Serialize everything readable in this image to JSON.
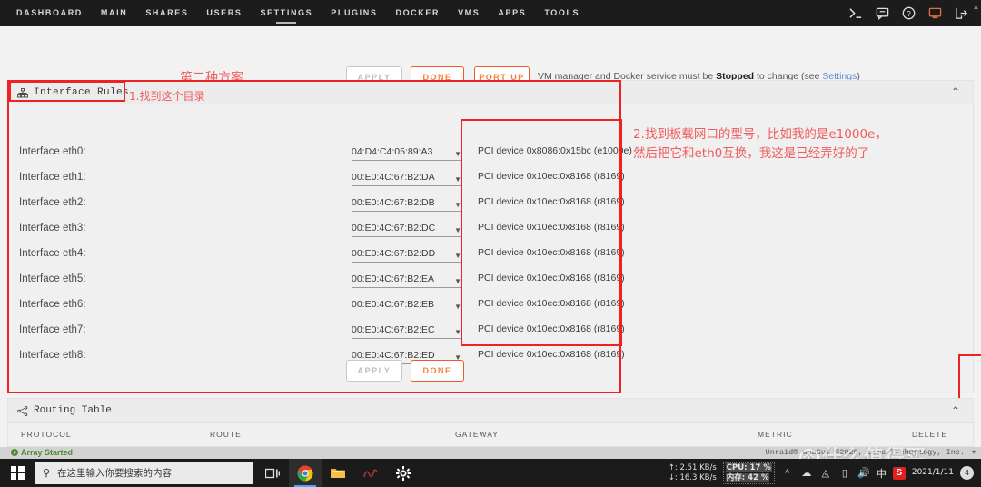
{
  "nav": {
    "items": [
      {
        "label": "DASHBOARD",
        "active": false
      },
      {
        "label": "MAIN",
        "active": false
      },
      {
        "label": "SHARES",
        "active": false
      },
      {
        "label": "USERS",
        "active": false
      },
      {
        "label": "SETTINGS",
        "active": true
      },
      {
        "label": "PLUGINS",
        "active": false
      },
      {
        "label": "DOCKER",
        "active": false
      },
      {
        "label": "VMS",
        "active": false
      },
      {
        "label": "APPS",
        "active": false
      },
      {
        "label": "TOOLS",
        "active": false
      }
    ],
    "right_icons": [
      "terminal-icon",
      "chat-icon",
      "help-icon",
      "display-icon",
      "logout-icon"
    ],
    "scroll_arrow": "▲"
  },
  "header": {
    "annotation_title": "第二种方案",
    "apply_label": "APPLY",
    "done_label": "DONE",
    "port_up_label": "PORT UP",
    "note_prefix": "VM manager and Docker service must be ",
    "note_bold": "Stopped",
    "note_middle": " to change (see ",
    "note_link": "Settings",
    "note_suffix": ")"
  },
  "panel": {
    "title": "Interface Rules",
    "icon": "sitemap-icon",
    "collapse_icon": "⌃",
    "rows": [
      {
        "label": "Interface eth0:",
        "mac": "04:D4:C4:05:89:A3",
        "pci": "PCI device 0x8086:0x15bc (e1000e)"
      },
      {
        "label": "Interface eth1:",
        "mac": "00:E0:4C:67:B2:DA",
        "pci": "PCI device 0x10ec:0x8168 (r8169)"
      },
      {
        "label": "Interface eth2:",
        "mac": "00:E0:4C:67:B2:DB",
        "pci": "PCI device 0x10ec:0x8168 (r8169)"
      },
      {
        "label": "Interface eth3:",
        "mac": "00:E0:4C:67:B2:DC",
        "pci": "PCI device 0x10ec:0x8168 (r8169)"
      },
      {
        "label": "Interface eth4:",
        "mac": "00:E0:4C:67:B2:DD",
        "pci": "PCI device 0x10ec:0x8168 (r8169)"
      },
      {
        "label": "Interface eth5:",
        "mac": "00:E0:4C:67:B2:EA",
        "pci": "PCI device 0x10ec:0x8168 (r8169)"
      },
      {
        "label": "Interface eth6:",
        "mac": "00:E0:4C:67:B2:EB",
        "pci": "PCI device 0x10ec:0x8168 (r8169)"
      },
      {
        "label": "Interface eth7:",
        "mac": "00:E0:4C:67:B2:EC",
        "pci": "PCI device 0x10ec:0x8168 (r8169)"
      },
      {
        "label": "Interface eth8:",
        "mac": "00:E0:4C:67:B2:ED",
        "pci": "PCI device 0x10ec:0x8168 (r8169)"
      }
    ],
    "apply_label": "APPLY",
    "done_label": "DONE"
  },
  "annotations": {
    "step1": "1.找到这个目录",
    "step2_line1": "2.找到板载网口的型号，比如我的是e1000e，",
    "step2_line2": "然后把它和eth0互换，我这是已经弄好的了",
    "box_color": "#ee2222",
    "text_color": "#f05c5c"
  },
  "routing": {
    "title": "Routing Table",
    "icon": "share-alt-icon",
    "collapse_icon": "⌃",
    "columns": [
      "PROTOCOL",
      "ROUTE",
      "GATEWAY",
      "METRIC",
      "DELETE"
    ]
  },
  "status": {
    "array": "Array Started",
    "copyright": "Unraid® webGui ©2020, Lime Technology, Inc.",
    "caret": "▾"
  },
  "watermark": {
    "circle": "个",
    "text": "什么值得买"
  },
  "taskbar": {
    "search_placeholder": "在这里输入你要搜索的内容",
    "search_icon": "magnifier-icon",
    "icons": [
      "task-view-icon",
      "chrome-icon",
      "file-explorer-icon",
      "squirrel-icon",
      "settings-gear-icon"
    ],
    "net_up": "↑: 2.51 KB/s",
    "net_down": "↓: 16.3 KB/s",
    "cpu": "CPU: 17 %",
    "mem": "内存: 42 %",
    "ime": "中",
    "sogou": "S",
    "date": "2021/1/11",
    "notification_count": "4"
  }
}
